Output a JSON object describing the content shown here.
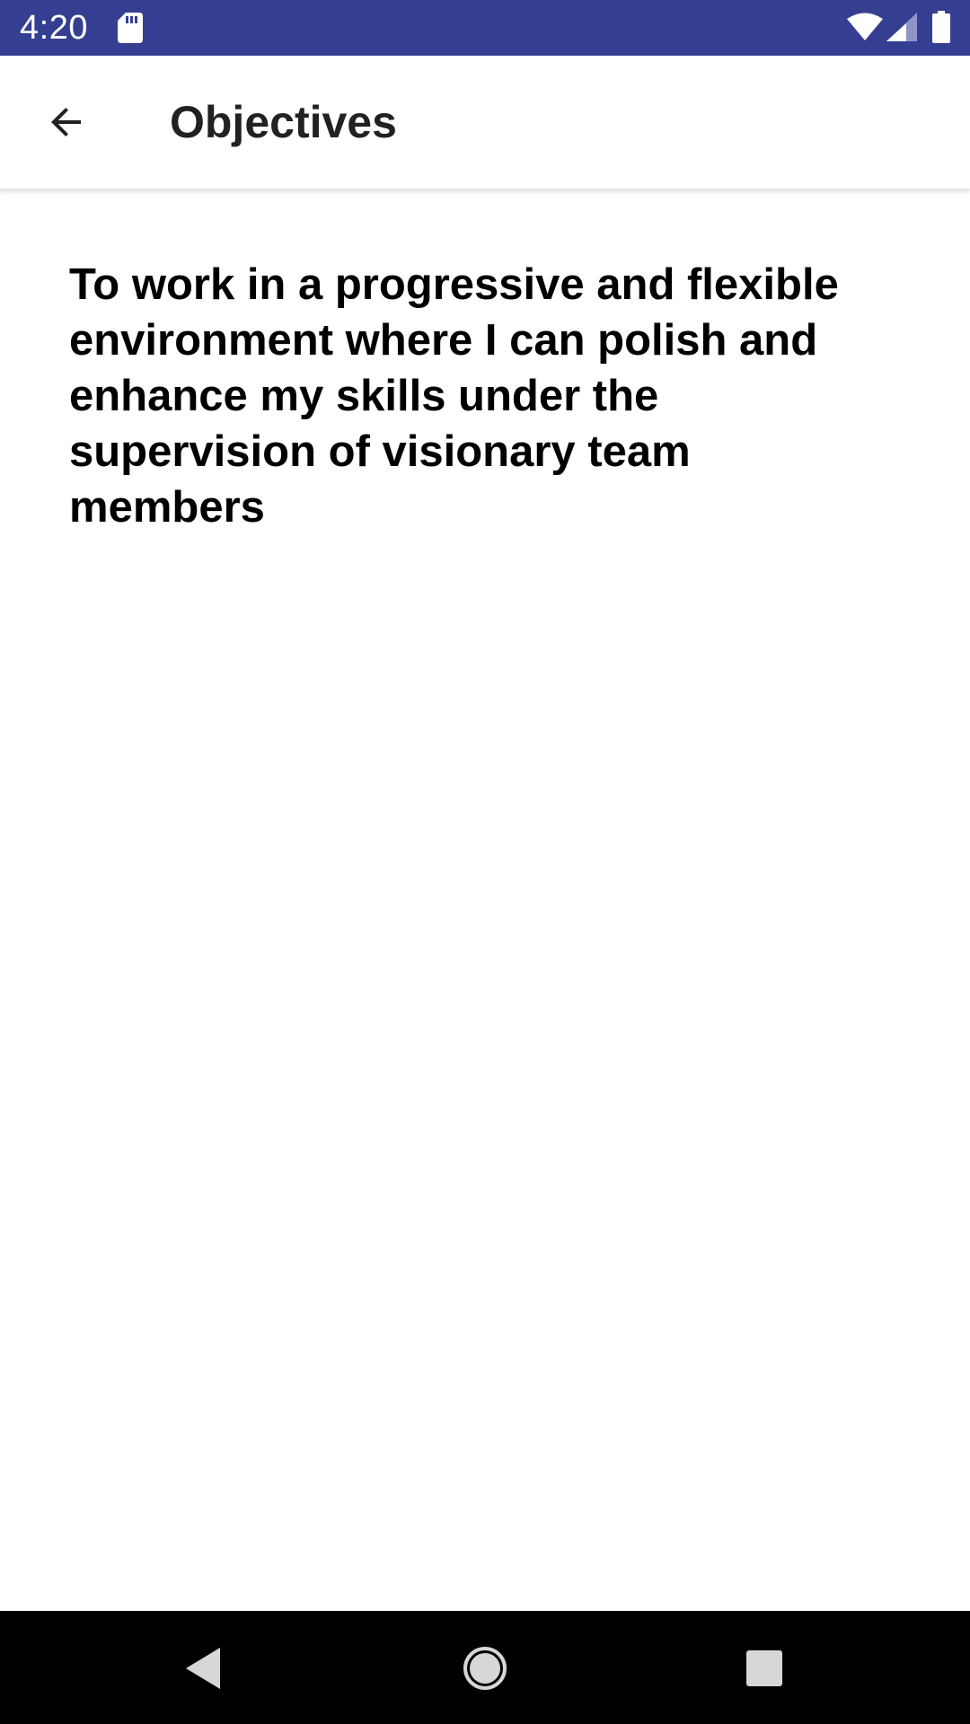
{
  "status_bar": {
    "time": "4:20",
    "background_color": "#353f92",
    "icons": [
      "sd-card-icon",
      "wifi-icon",
      "cell-signal-icon",
      "battery-icon"
    ]
  },
  "app_bar": {
    "title": "Objectives",
    "back_icon": "arrow-left-icon"
  },
  "content": {
    "objective_text": "To work in a progressive and flexible environment where I can polish and enhance my skills under the supervision of visionary team members"
  },
  "nav_bar": {
    "icons": [
      "nav-back-icon",
      "nav-home-icon",
      "nav-recents-icon"
    ]
  }
}
